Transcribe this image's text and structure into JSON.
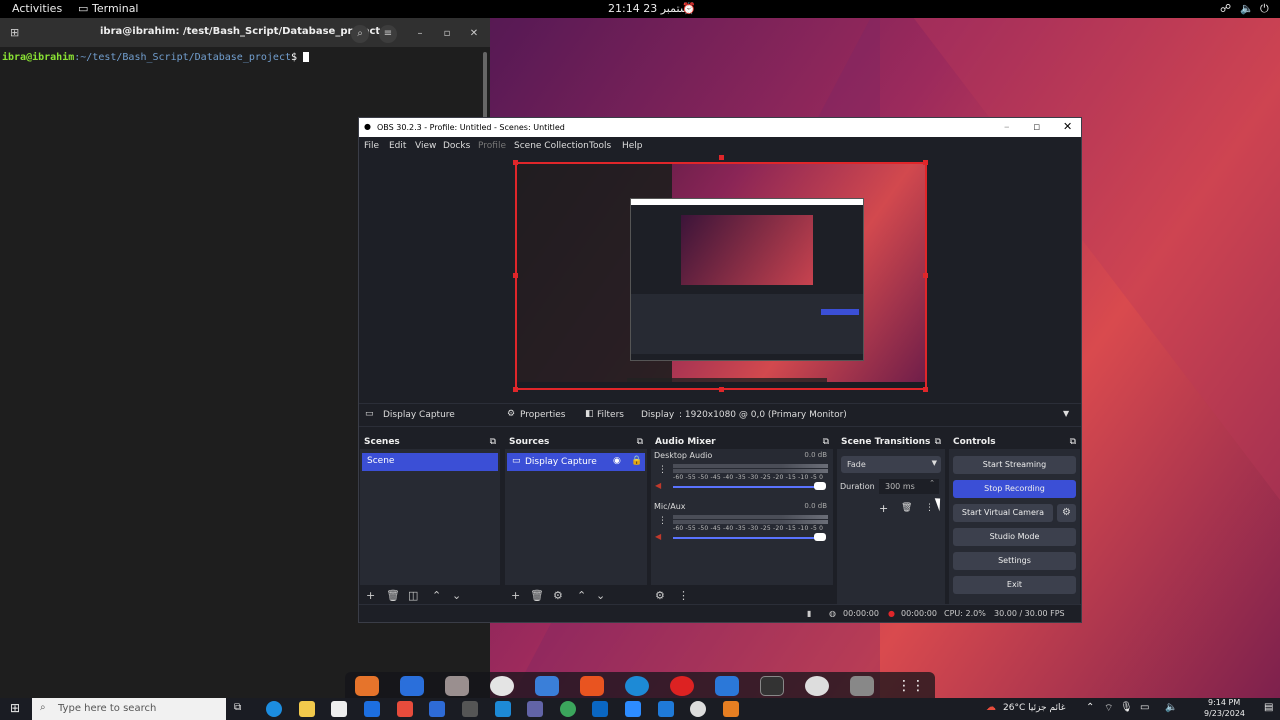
{
  "topbar": {
    "activities": "Activities",
    "app": "Terminal",
    "clock": "21:14  23 ستمبر",
    "icons": [
      "network-icon",
      "volume-icon",
      "power-icon"
    ]
  },
  "terminal": {
    "title": "ibra@ibrahim: /test/Bash_Script/Database_project",
    "prompt_user": "ibra@ibrahim",
    "prompt_path": ":~/test/Bash_Script/Database_project",
    "prompt_symbol": "$"
  },
  "obs": {
    "title": "OBS 30.2.3 - Profile: Untitled - Scenes: Untitled",
    "menu": [
      "File",
      "Edit",
      "View",
      "Docks",
      "Profile",
      "Scene Collection",
      "Tools",
      "Help"
    ],
    "source_toolbar": {
      "source_name": "Display Capture",
      "properties": "Properties",
      "filters": "Filters",
      "display_label": "Display",
      "display_value": ": 1920x1080 @ 0,0 (Primary Monitor)"
    },
    "docks": {
      "scenes": {
        "title": "Scenes",
        "items": [
          "Scene"
        ]
      },
      "sources": {
        "title": "Sources",
        "items": [
          "Display Capture"
        ]
      },
      "mixer": {
        "title": "Audio Mixer",
        "channels": [
          {
            "name": "Desktop Audio",
            "db": "0.0 dB"
          },
          {
            "name": "Mic/Aux",
            "db": "0.0 dB"
          }
        ],
        "ticks": "-60 -55 -50 -45 -40 -35 -30 -25 -20 -15 -10 -5 0"
      },
      "transitions": {
        "title": "Scene Transitions",
        "type": "Fade",
        "duration_label": "Duration",
        "duration_value": "300 ms"
      },
      "controls": {
        "title": "Controls",
        "buttons": [
          "Start Streaming",
          "Stop Recording",
          "Start Virtual Camera",
          "Studio Mode",
          "Settings",
          "Exit"
        ]
      }
    },
    "status": {
      "stream_time": "00:00:00",
      "rec_time": "00:00:00",
      "cpu": "CPU: 2.0%",
      "fps": "30.00 / 30.00 FPS"
    }
  },
  "taskbar": {
    "search_placeholder": "Type here to search",
    "weather": "26°C  غائم جزئيا",
    "time": "9:14 PM",
    "date": "9/23/2024"
  }
}
